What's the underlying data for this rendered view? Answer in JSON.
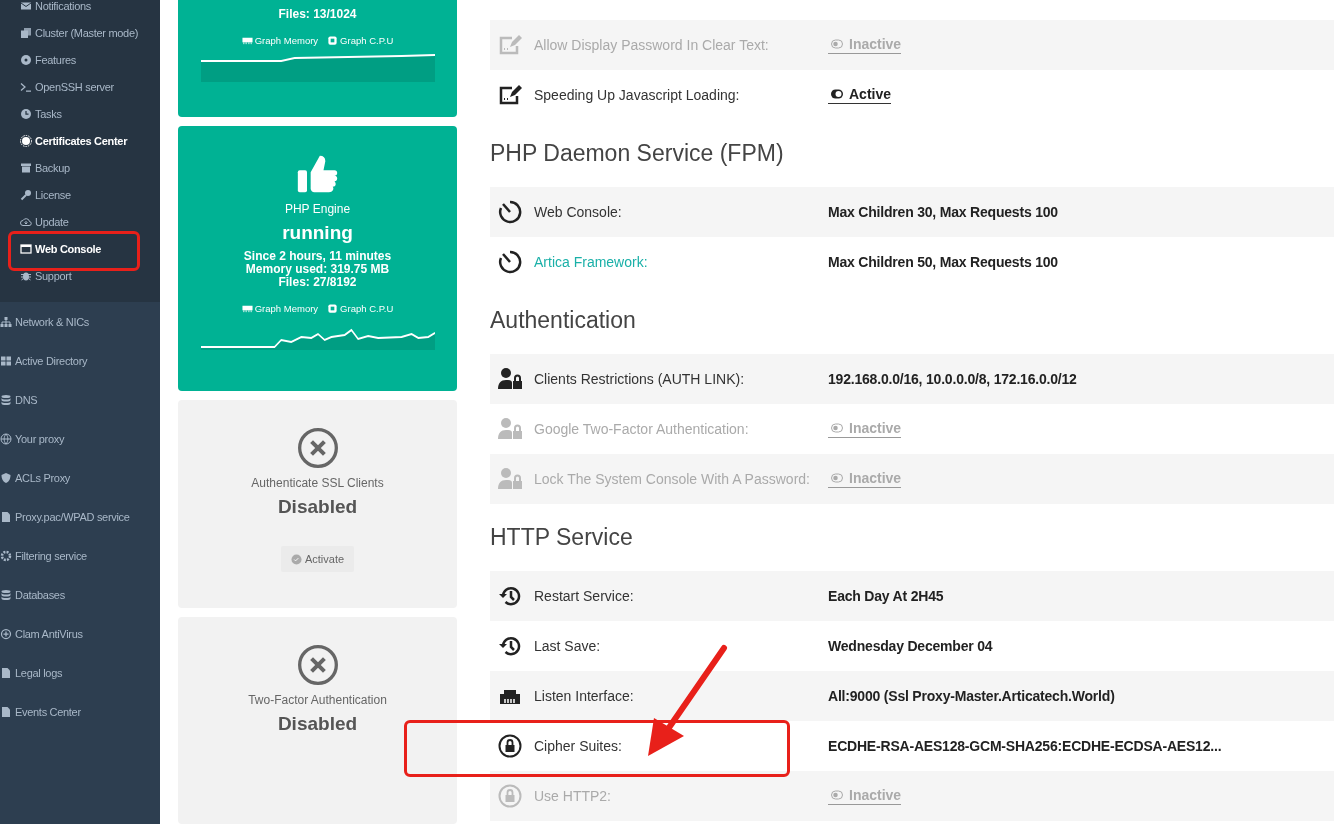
{
  "sidebar": {
    "groups": [
      {
        "kind": "sub",
        "items": [
          {
            "label": "Notifications",
            "selected": false
          },
          {
            "label": "Cluster (Master mode)",
            "selected": false
          },
          {
            "label": "Features",
            "selected": false
          },
          {
            "label": "OpenSSH server",
            "selected": false
          },
          {
            "label": "Tasks",
            "selected": false
          },
          {
            "label": "Certificates Center",
            "selected": true
          },
          {
            "label": "Backup",
            "selected": false
          },
          {
            "label": "License",
            "selected": false
          },
          {
            "label": "Update",
            "selected": false
          },
          {
            "label": "Web Console",
            "selected": true
          },
          {
            "label": "Support",
            "selected": false
          }
        ]
      },
      {
        "kind": "main",
        "items": [
          {
            "label": "Network & NICs",
            "selected": false
          },
          {
            "label": "Active Directory",
            "selected": false
          },
          {
            "label": "DNS",
            "selected": false
          },
          {
            "label": "Your proxy",
            "selected": false
          },
          {
            "label": "ACLs Proxy",
            "selected": false
          },
          {
            "label": "Proxy.pac/WPAD service",
            "selected": false
          },
          {
            "label": "Filtering service",
            "selected": false
          },
          {
            "label": "Databases",
            "selected": false
          },
          {
            "label": "Clam AntiVirus",
            "selected": false
          },
          {
            "label": "Legal logs",
            "selected": false
          },
          {
            "label": "Events Center",
            "selected": false
          }
        ]
      }
    ]
  },
  "cards": [
    {
      "kind": "running",
      "details": [
        "Files: 13/1024"
      ],
      "graph_links": [
        "Graph Memory",
        "Graph C.P.U"
      ]
    },
    {
      "kind": "running",
      "title": "PHP Engine",
      "status": "running",
      "details": [
        "Since 2 hours, 11 minutes",
        "Memory used: 319.75 MB",
        "Files: 27/8192"
      ],
      "graph_links": [
        "Graph Memory",
        "Graph C.P.U"
      ]
    },
    {
      "kind": "disabled",
      "title": "Authenticate SSL Clients",
      "status": "Disabled",
      "button": "Activate"
    },
    {
      "kind": "disabled",
      "title": "Two-Factor Authentication",
      "status": "Disabled"
    }
  ],
  "sections": [
    {
      "rows": [
        {
          "label": "Allow Display Password In Clear Text:",
          "link": false,
          "disabled": true,
          "value": {
            "kind": "toggle",
            "text": "Inactive",
            "on": false
          }
        },
        {
          "label": "Speeding Up Javascript Loading:",
          "link": false,
          "disabled": false,
          "value": {
            "kind": "toggle",
            "text": "Active",
            "on": true
          }
        }
      ]
    },
    {
      "heading": "PHP Daemon Service (FPM)",
      "rows": [
        {
          "label": "Web Console:",
          "link": false,
          "disabled": false,
          "value": {
            "kind": "text",
            "text": "Max Children 30, Max Requests 100"
          }
        },
        {
          "label": "Artica Framework:",
          "link": true,
          "disabled": false,
          "value": {
            "kind": "text",
            "text": "Max Children 50, Max Requests 100"
          }
        }
      ]
    },
    {
      "heading": "Authentication",
      "rows": [
        {
          "label": "Clients Restrictions (AUTH LINK):",
          "link": false,
          "disabled": false,
          "value": {
            "kind": "text",
            "text": "192.168.0.0/16, 10.0.0.0/8, 172.16.0.0/12"
          }
        },
        {
          "label": "Google Two-Factor Authentication:",
          "link": false,
          "disabled": true,
          "value": {
            "kind": "toggle",
            "text": "Inactive",
            "on": false
          }
        },
        {
          "label": "Lock The System Console With A Password:",
          "link": false,
          "disabled": true,
          "value": {
            "kind": "toggle",
            "text": "Inactive",
            "on": false
          }
        }
      ]
    },
    {
      "heading": "HTTP Service",
      "rows": [
        {
          "label": "Restart Service:",
          "link": false,
          "disabled": false,
          "value": {
            "kind": "text",
            "text": "Each Day At 2H45"
          }
        },
        {
          "label": "Last Save:",
          "link": false,
          "disabled": false,
          "value": {
            "kind": "text",
            "text": "Wednesday December 04"
          }
        },
        {
          "label": "Listen Interface:",
          "link": false,
          "disabled": false,
          "value": {
            "kind": "text",
            "text": "All:9000 (Ssl Proxy-Master.Articatech.World)"
          }
        },
        {
          "label": "Cipher Suites:",
          "link": false,
          "disabled": false,
          "value": {
            "kind": "text",
            "text": "ECDHE-RSA-AES128-GCM-SHA256:ECDHE-ECDSA-AES12..."
          }
        },
        {
          "label": "Use HTTP2:",
          "link": false,
          "disabled": true,
          "value": {
            "kind": "toggle",
            "text": "Inactive",
            "on": false
          }
        }
      ]
    }
  ]
}
